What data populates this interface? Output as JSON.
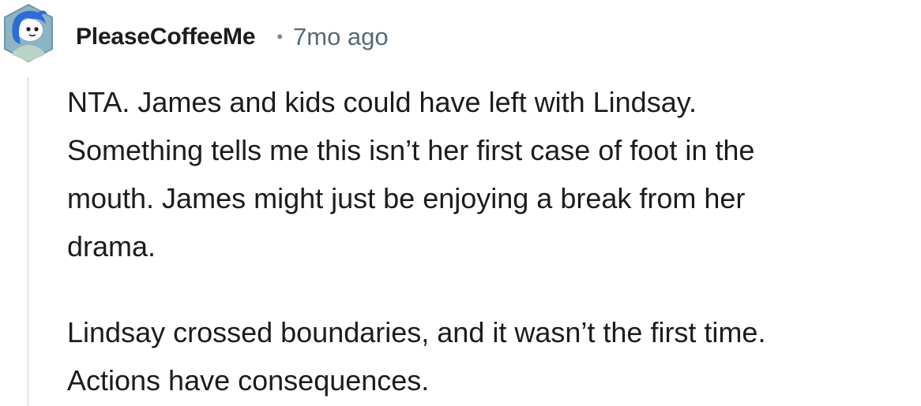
{
  "comment": {
    "username": "PleaseCoffeeMe",
    "separator": "•",
    "timestamp": "7mo ago",
    "paragraphs": [
      "NTA. James and kids could have left with Lindsay.\nSomething tells me this isn’t her first case of foot in the\nmouth. James might just be enjoying a break from her\ndrama.",
      "Lindsay crossed boundaries, and it wasn’t the first time.\nActions have consequences."
    ],
    "avatar_icon": "snoo-avatar-icon",
    "colors": {
      "avatar_bg": "#7fa8b8",
      "avatar_hair": "#2f6bd9",
      "username": "#1c1c1c",
      "timestamp": "#586a75",
      "thread_line": "#e8ecee"
    }
  }
}
